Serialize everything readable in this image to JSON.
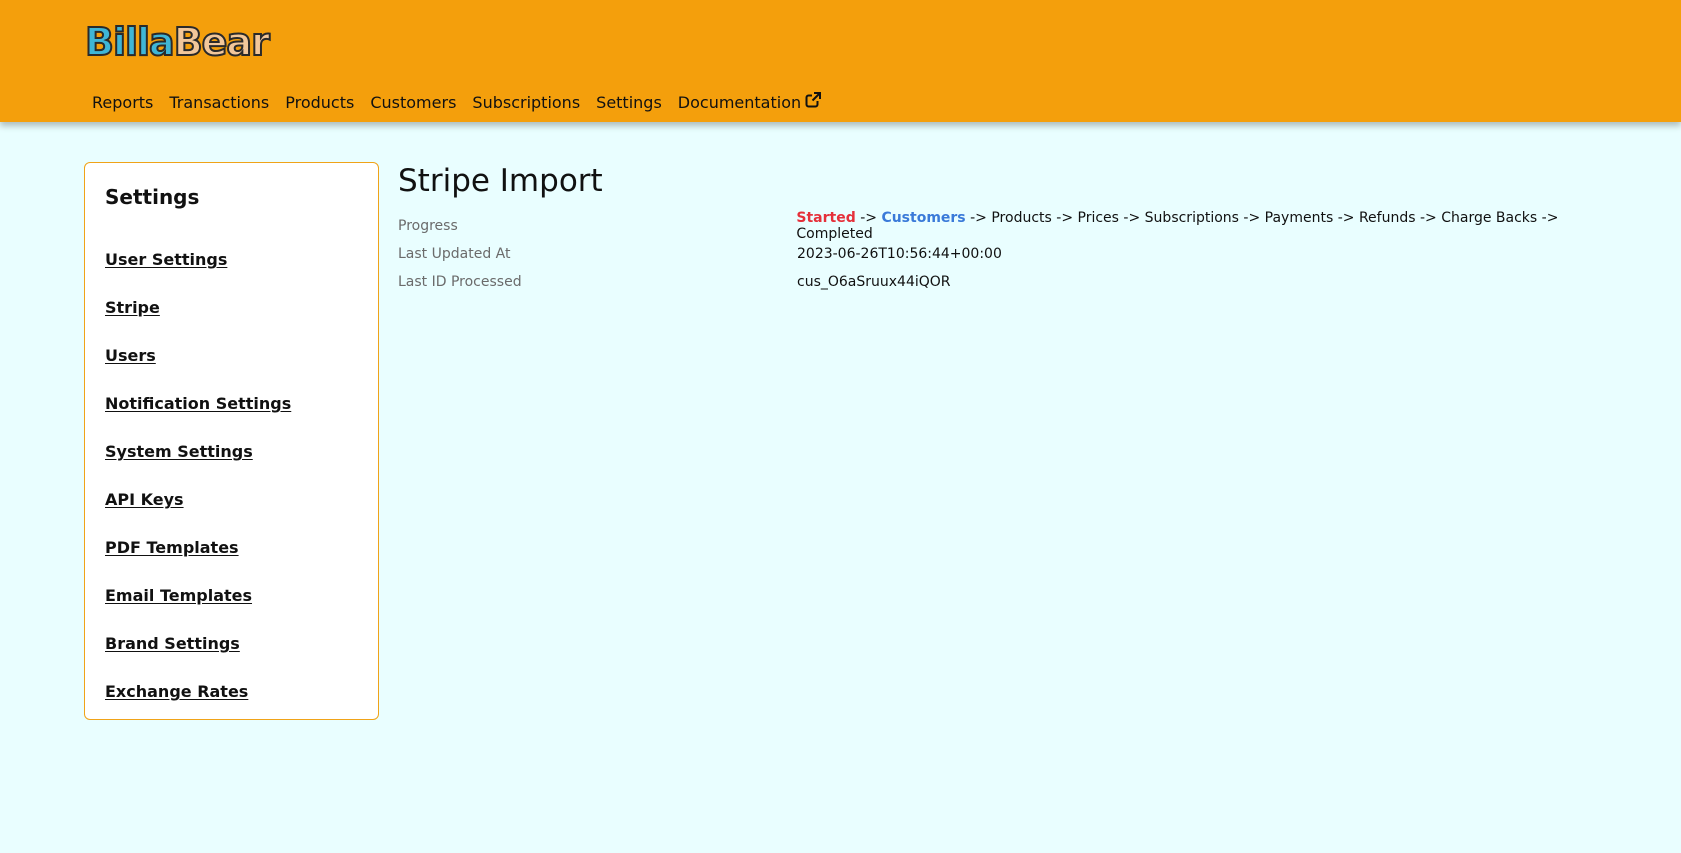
{
  "app": {
    "logo_part1": "Billa",
    "logo_part2": "Bear"
  },
  "nav": {
    "items": [
      "Reports",
      "Transactions",
      "Products",
      "Customers",
      "Subscriptions",
      "Settings",
      "Documentation"
    ],
    "external_icon": "external-link-icon"
  },
  "sidebar": {
    "title": "Settings",
    "items": [
      "User Settings",
      "Stripe",
      "Users",
      "Notification Settings",
      "System Settings",
      "API Keys",
      "PDF Templates",
      "Email Templates",
      "Brand Settings",
      "Exchange Rates"
    ]
  },
  "main": {
    "title": "Stripe Import",
    "progress_label": "Progress",
    "progress_steps": [
      "Started",
      "Customers",
      "Products",
      "Prices",
      "Subscriptions",
      "Payments",
      "Refunds",
      "Charge Backs",
      "Completed"
    ],
    "progress_separator": "->",
    "last_updated_label": "Last Updated At",
    "last_updated_value": "2023-06-26T10:56:44+00:00",
    "last_id_label": "Last ID Processed",
    "last_id_value": "cus_O6aSruux44iQOR"
  },
  "colors": {
    "header": "#f49f0c",
    "background": "#e9feff",
    "step_done": "#e5303a",
    "step_current": "#3a7ad9"
  }
}
